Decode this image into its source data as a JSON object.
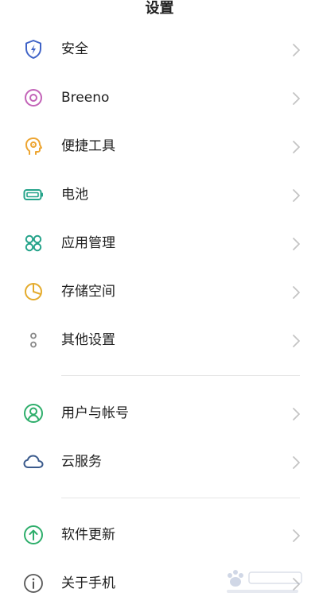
{
  "header": {
    "title": "设置"
  },
  "colors": {
    "chevron": "#c4c4c4",
    "security_icon": "#3f63c7",
    "breeno_icon": "#c364b8",
    "shortcut_icon": "#eda532",
    "battery_icon": "#25a38a",
    "apps_icon": "#25a38a",
    "storage_icon": "#e4ab2c",
    "other_icon": "#888888",
    "account_icon": "#2eae6b",
    "cloud_icon": "#3a5a8c",
    "update_icon": "#2eae6b",
    "about_icon": "#555555"
  },
  "groups": [
    {
      "items": [
        {
          "label": "安全",
          "icon": "shield-icon"
        },
        {
          "label": "Breeno",
          "icon": "breeno-ring-icon"
        },
        {
          "label": "便捷工具",
          "icon": "head-gear-icon"
        },
        {
          "label": "电池",
          "icon": "battery-icon"
        },
        {
          "label": "应用管理",
          "icon": "apps-grid-icon"
        },
        {
          "label": "存储空间",
          "icon": "pie-chart-icon"
        },
        {
          "label": "其他设置",
          "icon": "more-dots-icon"
        }
      ]
    },
    {
      "items": [
        {
          "label": "用户与帐号",
          "icon": "user-circle-icon"
        },
        {
          "label": "云服务",
          "icon": "cloud-icon"
        }
      ]
    },
    {
      "items": [
        {
          "label": "软件更新",
          "icon": "arrow-up-circle-icon"
        },
        {
          "label": "关于手机",
          "icon": "info-icon"
        }
      ]
    }
  ]
}
